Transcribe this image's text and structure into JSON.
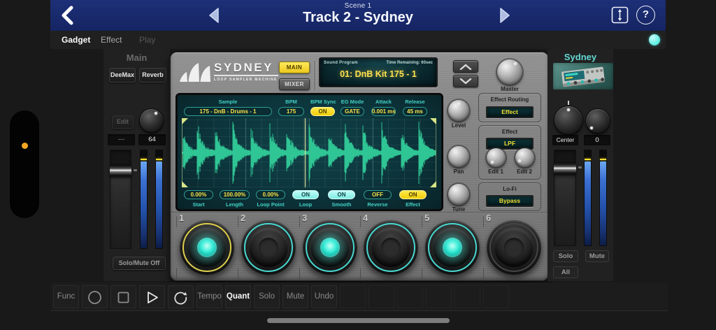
{
  "colors": {
    "accent_cyan": "#49d8d1",
    "accent_yellow": "#ffe100",
    "navy": "#182a6a",
    "waveform_green": "#2fc594",
    "meter_blue": "#3b70d2"
  },
  "top_bar": {
    "scene_label": "Scene 1",
    "track_title": "Track 2 - Sydney",
    "help_label": "?"
  },
  "tab_bar": {
    "tabs": [
      {
        "label": "Gadget",
        "state": "active"
      },
      {
        "label": "Effect",
        "state": "normal"
      },
      {
        "label": "Play",
        "state": "disabled"
      }
    ]
  },
  "left_panel": {
    "title": "Main",
    "fx_slots": [
      "DeeMax",
      "Reverb"
    ],
    "edit_label": "Edit",
    "send_value": "---",
    "knob_value": "64",
    "solo_mute_label": "Solo/Mute Off"
  },
  "device": {
    "brand": "SYDNEY",
    "brand_sub": "LOOP SAMPLER MACHINE",
    "view_main": "MAIN",
    "view_mixer": "MIXER",
    "program": {
      "label": "Sound Program",
      "time_remaining": "Time Remaining: 60sec",
      "value": "01: DnB Kit 175 - 1"
    },
    "master_label": "Master",
    "params_top": [
      {
        "label": "Sample",
        "value": "175 - DnB - Drums - 1",
        "style": "value"
      },
      {
        "label": "BPM",
        "value": "175",
        "style": "value"
      },
      {
        "label": "BPM Sync",
        "value": "ON",
        "style": "on-yellow"
      },
      {
        "label": "EG Mode",
        "value": "GATE",
        "style": "value"
      },
      {
        "label": "Attack",
        "value": "0.001 ms",
        "style": "value"
      },
      {
        "label": "Release",
        "value": "45 ms",
        "style": "value"
      }
    ],
    "params_bottom": [
      {
        "label": "Start",
        "value": "0.00%",
        "style": "value"
      },
      {
        "label": "Length",
        "value": "100.00%",
        "style": "value"
      },
      {
        "label": "Loop Point",
        "value": "0.00%",
        "style": "value"
      },
      {
        "label": "Loop",
        "value": "ON",
        "style": "on-cyan"
      },
      {
        "label": "Smooth",
        "value": "ON",
        "style": "on-cyan"
      },
      {
        "label": "Reverse",
        "value": "OFF",
        "style": "value"
      },
      {
        "label": "Effect",
        "value": "ON",
        "style": "on-yellow"
      }
    ],
    "knobs": {
      "level": "Level",
      "pan": "Pan",
      "tune": "Tune"
    },
    "effect_routing": {
      "title": "Effect Routing",
      "value": "Effect"
    },
    "effect": {
      "title": "Effect",
      "value": "LPF",
      "edit1_label": "Edit 1",
      "edit2_label": "Edit 2"
    },
    "lofi": {
      "title": "Lo-Fi",
      "value": "Bypass"
    },
    "pads": [
      {
        "number": "1",
        "ring": "yellow",
        "lit": true
      },
      {
        "number": "2",
        "ring": "cyan",
        "lit": false
      },
      {
        "number": "3",
        "ring": "cyan",
        "lit": true
      },
      {
        "number": "4",
        "ring": "cyan",
        "lit": false
      },
      {
        "number": "5",
        "ring": "cyan",
        "lit": true
      },
      {
        "number": "6",
        "ring": "none",
        "lit": false
      }
    ],
    "waveform": {
      "color": "#2fc594",
      "seed": 20,
      "playhead_pos": 0.483,
      "hits": [
        {
          "p": 0.005,
          "a": 0.55
        },
        {
          "p": 0.06,
          "a": 0.95
        },
        {
          "p": 0.13,
          "a": 0.85
        },
        {
          "p": 0.2,
          "a": 0.9
        },
        {
          "p": 0.27,
          "a": 0.8
        },
        {
          "p": 0.345,
          "a": 0.9
        },
        {
          "p": 0.41,
          "a": 0.85
        },
        {
          "p": 0.5,
          "a": 0.95
        },
        {
          "p": 0.575,
          "a": 0.7
        },
        {
          "p": 0.64,
          "a": 0.9
        },
        {
          "p": 0.71,
          "a": 0.85
        },
        {
          "p": 0.785,
          "a": 0.9
        },
        {
          "p": 0.86,
          "a": 0.8
        },
        {
          "p": 0.93,
          "a": 0.95
        }
      ]
    }
  },
  "right_panel": {
    "title": "Sydney",
    "pan_value": "Center",
    "gain_value": "0",
    "solo_label": "Solo",
    "mute_label": "Mute",
    "all_label": "All"
  },
  "toolbar": {
    "func_label": "Func",
    "tempo_label": "Tempo",
    "quant_label": "Quant",
    "solo_label": "Solo",
    "mute_label": "Mute",
    "undo_label": "Undo"
  }
}
